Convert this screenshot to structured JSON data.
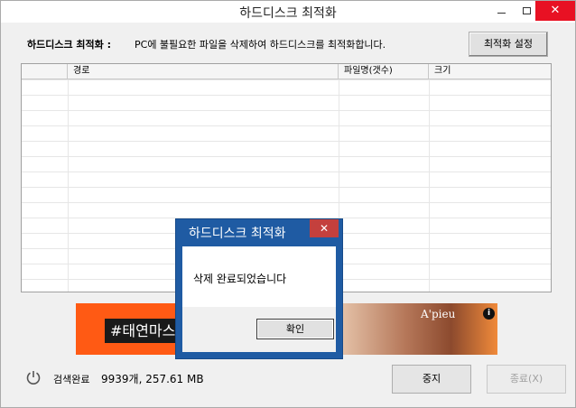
{
  "window": {
    "title": "하드디스크 최적화",
    "min_glyph": "",
    "close_glyph": "✕"
  },
  "description": {
    "label": "하드디스크 최적화 :",
    "text": "PC에 불필요한 파일을 삭제하여 하드디스크를 최적화합니다."
  },
  "buttons": {
    "settings": "최적화 설정",
    "stop": "중지",
    "exit": "종료(X)"
  },
  "grid": {
    "columns": [
      "",
      "경로",
      "파일명(갯수)",
      "크기"
    ],
    "rows": []
  },
  "banner": {
    "tag": "#태연마스",
    "brand": "A'pieu",
    "info": "i"
  },
  "status": {
    "label": "검색완료",
    "value": "9939개, 257.61 MB",
    "icon": "power-icon"
  },
  "dialog": {
    "title": "하드디스크 최적화",
    "message": "삭제 완료되었습니다",
    "ok": "확인",
    "close_glyph": "✕"
  },
  "colors": {
    "dialog_frame": "#1f5ba3",
    "dialog_close": "#c4403d",
    "window_close": "#e81123",
    "banner": "#ff5a14"
  }
}
